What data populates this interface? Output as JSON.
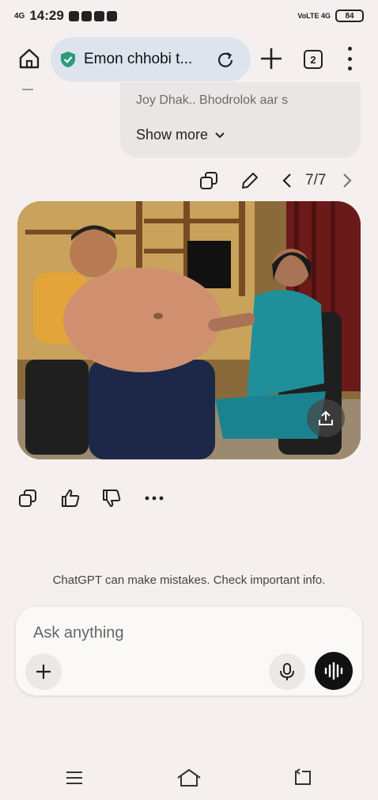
{
  "status_bar": {
    "network": "4G",
    "time": "14:29",
    "volte": "VoLTE 4G",
    "battery": "84"
  },
  "browser": {
    "url_title": "Emon chhobi t...",
    "tab_count": "2"
  },
  "message": {
    "truncated_text": "Joy Dhak.. Bhodrolok aar s",
    "show_more": "Show more"
  },
  "edit_row": {
    "page_indicator": "7/7"
  },
  "disclaimer": "ChatGPT can make mistakes. Check important info.",
  "composer": {
    "placeholder": "Ask anything"
  },
  "colors": {
    "background": "#f5efef",
    "url_pill": "#dde4ee",
    "shield_green": "#2e9a7a",
    "voice_button": "#111111"
  }
}
